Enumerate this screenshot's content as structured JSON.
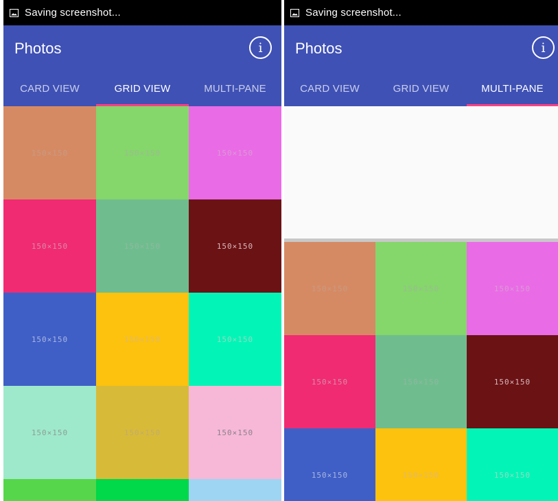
{
  "status_text": "Saving screenshot...",
  "app_title": "Photos",
  "info_glyph": "i",
  "accent_color": "#ff4081",
  "primary_color": "#3f51b5",
  "tabs": [
    "CARD VIEW",
    "GRID VIEW",
    "MULTI-PANE"
  ],
  "left_screen": {
    "active_tab": "GRID VIEW",
    "tiles": [
      {
        "label": "150×150",
        "bg": "#d68a64",
        "fg": "#c89a80"
      },
      {
        "label": "150×150",
        "bg": "#85d66b",
        "fg": "#9bbc90"
      },
      {
        "label": "150×150",
        "bg": "#ea6be6",
        "fg": "#d99ad6"
      },
      {
        "label": "150×150",
        "bg": "#f02b72",
        "fg": "#d98aa6"
      },
      {
        "label": "150×150",
        "bg": "#6fbd8e",
        "fg": "#8fb8a0"
      },
      {
        "label": "150×150",
        "bg": "#6b1215",
        "fg": "#d8b9ba"
      },
      {
        "label": "150×150",
        "bg": "#3f5fc7",
        "fg": "#a9b6df"
      },
      {
        "label": "150×150",
        "bg": "#fcc20d",
        "fg": "#e3b96a"
      },
      {
        "label": "150×150",
        "bg": "#02f5b6",
        "fg": "#8fdcc5"
      },
      {
        "label": "150×150",
        "bg": "#9ee9cb",
        "fg": "#8c9f98"
      },
      {
        "label": "150×150",
        "bg": "#d8ba39",
        "fg": "#c1ad6a"
      },
      {
        "label": "150×150",
        "bg": "#f7b8d8",
        "fg": "#8d8189"
      },
      {
        "label": "",
        "bg": "#56d64a",
        "fg": "#56d64a"
      },
      {
        "label": "",
        "bg": "#01d84a",
        "fg": "#01d84a"
      },
      {
        "label": "",
        "bg": "#9ed5f2",
        "fg": "#9ed5f2"
      }
    ]
  },
  "right_screen": {
    "active_tab": "MULTI-PANE",
    "tiles": [
      {
        "label": "150×150",
        "bg": "#d68a64",
        "fg": "#c89a80"
      },
      {
        "label": "150×150",
        "bg": "#85d66b",
        "fg": "#9bbc90"
      },
      {
        "label": "150×150",
        "bg": "#ea6be6",
        "fg": "#d99ad6"
      },
      {
        "label": "150×150",
        "bg": "#f02b72",
        "fg": "#d98aa6"
      },
      {
        "label": "150×150",
        "bg": "#6fbd8e",
        "fg": "#8fb8a0"
      },
      {
        "label": "150×150",
        "bg": "#6b1215",
        "fg": "#d8b9ba"
      },
      {
        "label": "150×150",
        "bg": "#3f5fc7",
        "fg": "#a9b6df"
      },
      {
        "label": "150×150",
        "bg": "#fcc20d",
        "fg": "#e3b96a"
      },
      {
        "label": "150×150",
        "bg": "#02f5b6",
        "fg": "#8fdcc5"
      }
    ]
  }
}
